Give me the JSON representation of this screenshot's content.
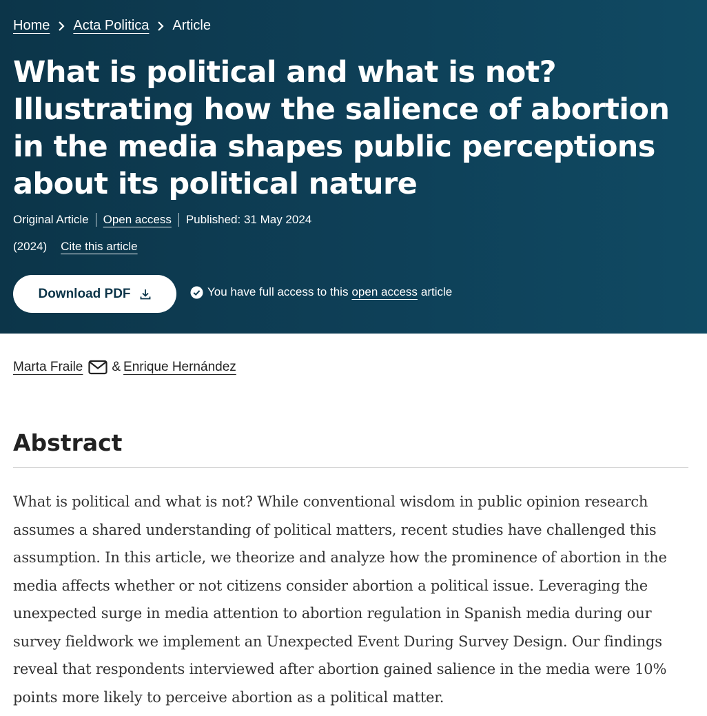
{
  "breadcrumb": {
    "home": "Home",
    "journal": "Acta Politica",
    "current": "Article"
  },
  "article": {
    "title": "What is political and what is not? Illustrating how the salience of abortion in the media shapes public perceptions about its political nature",
    "type": "Original Article",
    "access_label": "Open access",
    "published": "Published: 31 May 2024",
    "year": "(2024)",
    "cite_label": "Cite this article"
  },
  "download": {
    "label": "Download PDF",
    "icon": "download-icon"
  },
  "access_notice": {
    "prefix": "You have full access to this",
    "link": "open access",
    "suffix": "article",
    "icon": "check-circle-icon"
  },
  "authors": {
    "first": "Marta Fraile",
    "separator": "&",
    "second": "Enrique Hernández",
    "contact_icon": "mail-icon"
  },
  "abstract": {
    "heading": "Abstract",
    "text": "What is political and what is not? While conventional wisdom in public opinion research assumes a shared understanding of political matters, recent studies have challenged this assumption. In this article, we theorize and analyze how the prominence of abortion in the media affects whether or not citizens consider abortion a political issue. Leveraging the unexpected surge in media attention to abortion regulation in Spanish media during our survey fieldwork we implement an Unexpected Event During Survey Design. Our findings reveal that respondents interviewed after abortion gained salience in the media were 10% points more likely to perceive abortion as a political matter."
  },
  "colors": {
    "hero_bg": "#0c3549",
    "hero_text": "#ffffff",
    "button_bg": "#ffffff",
    "button_text": "#0c3549"
  }
}
